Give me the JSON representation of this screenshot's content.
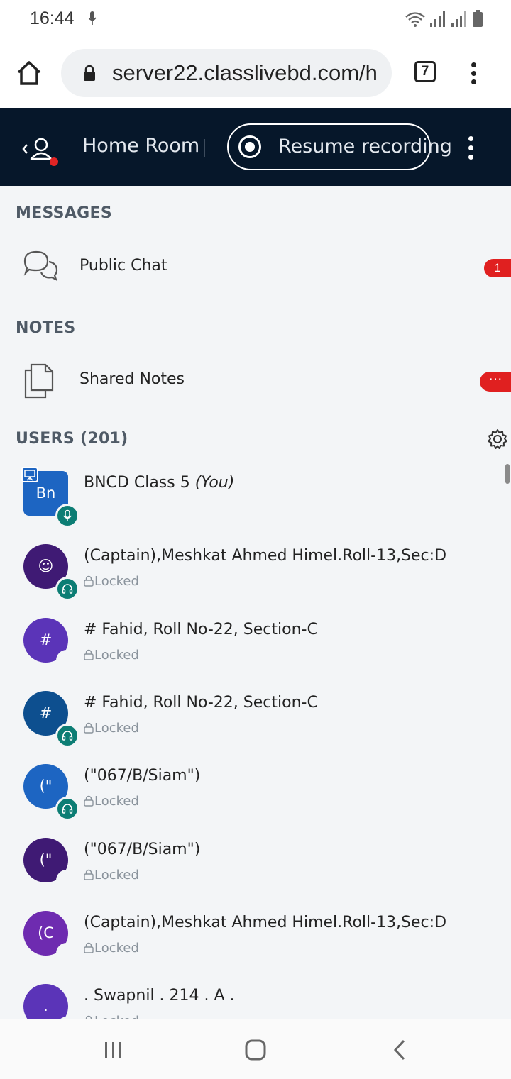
{
  "status_bar": {
    "time": "16:44"
  },
  "browser": {
    "url": "server22.classlivebd.com/h",
    "tab_count": "7"
  },
  "room_header": {
    "title": "Home Room",
    "recording_label": "Resume recording"
  },
  "messages": {
    "heading": "MESSAGES",
    "public_chat": {
      "label": "Public Chat",
      "unread": "1"
    }
  },
  "notes": {
    "heading": "NOTES",
    "shared_notes": {
      "label": "Shared Notes",
      "badge": "···"
    }
  },
  "users": {
    "heading": "USERS (201)",
    "list": [
      {
        "initials": "Bn",
        "name": "BNCD Class 5",
        "suffix": "(You)",
        "status": "",
        "color": "#1d65c2",
        "shape": "square",
        "indicator": "mic",
        "presenter": true
      },
      {
        "initials": "☺",
        "name": "(Captain),Meshkat Ahmed Himel.Roll-13,Sec:D",
        "status": "Locked",
        "color": "#3f1a74",
        "indicator": "headset"
      },
      {
        "initials": "#",
        "name": "# Fahid, Roll No-22, Section-C",
        "status": "Locked",
        "color": "#5b34b8",
        "indicator": "none"
      },
      {
        "initials": "#",
        "name": "# Fahid, Roll No-22, Section-C",
        "status": "Locked",
        "color": "#0d4f8f",
        "indicator": "headset"
      },
      {
        "initials": "(\"",
        "name": "(\"067/B/Siam\")",
        "status": "Locked",
        "color": "#1d65c2",
        "indicator": "headset"
      },
      {
        "initials": "(\"",
        "name": "(\"067/B/Siam\")",
        "status": "Locked",
        "color": "#3f1a74",
        "indicator": "none"
      },
      {
        "initials": "(C",
        "name": "(Captain),Meshkat Ahmed Himel.Roll-13,Sec:D",
        "status": "Locked",
        "color": "#6e2bb0",
        "indicator": "none"
      },
      {
        "initials": ".",
        "name": ". Swapnil . 214 . A .",
        "status": "Locked",
        "color": "#5b34b8",
        "indicator": "headset"
      }
    ]
  }
}
